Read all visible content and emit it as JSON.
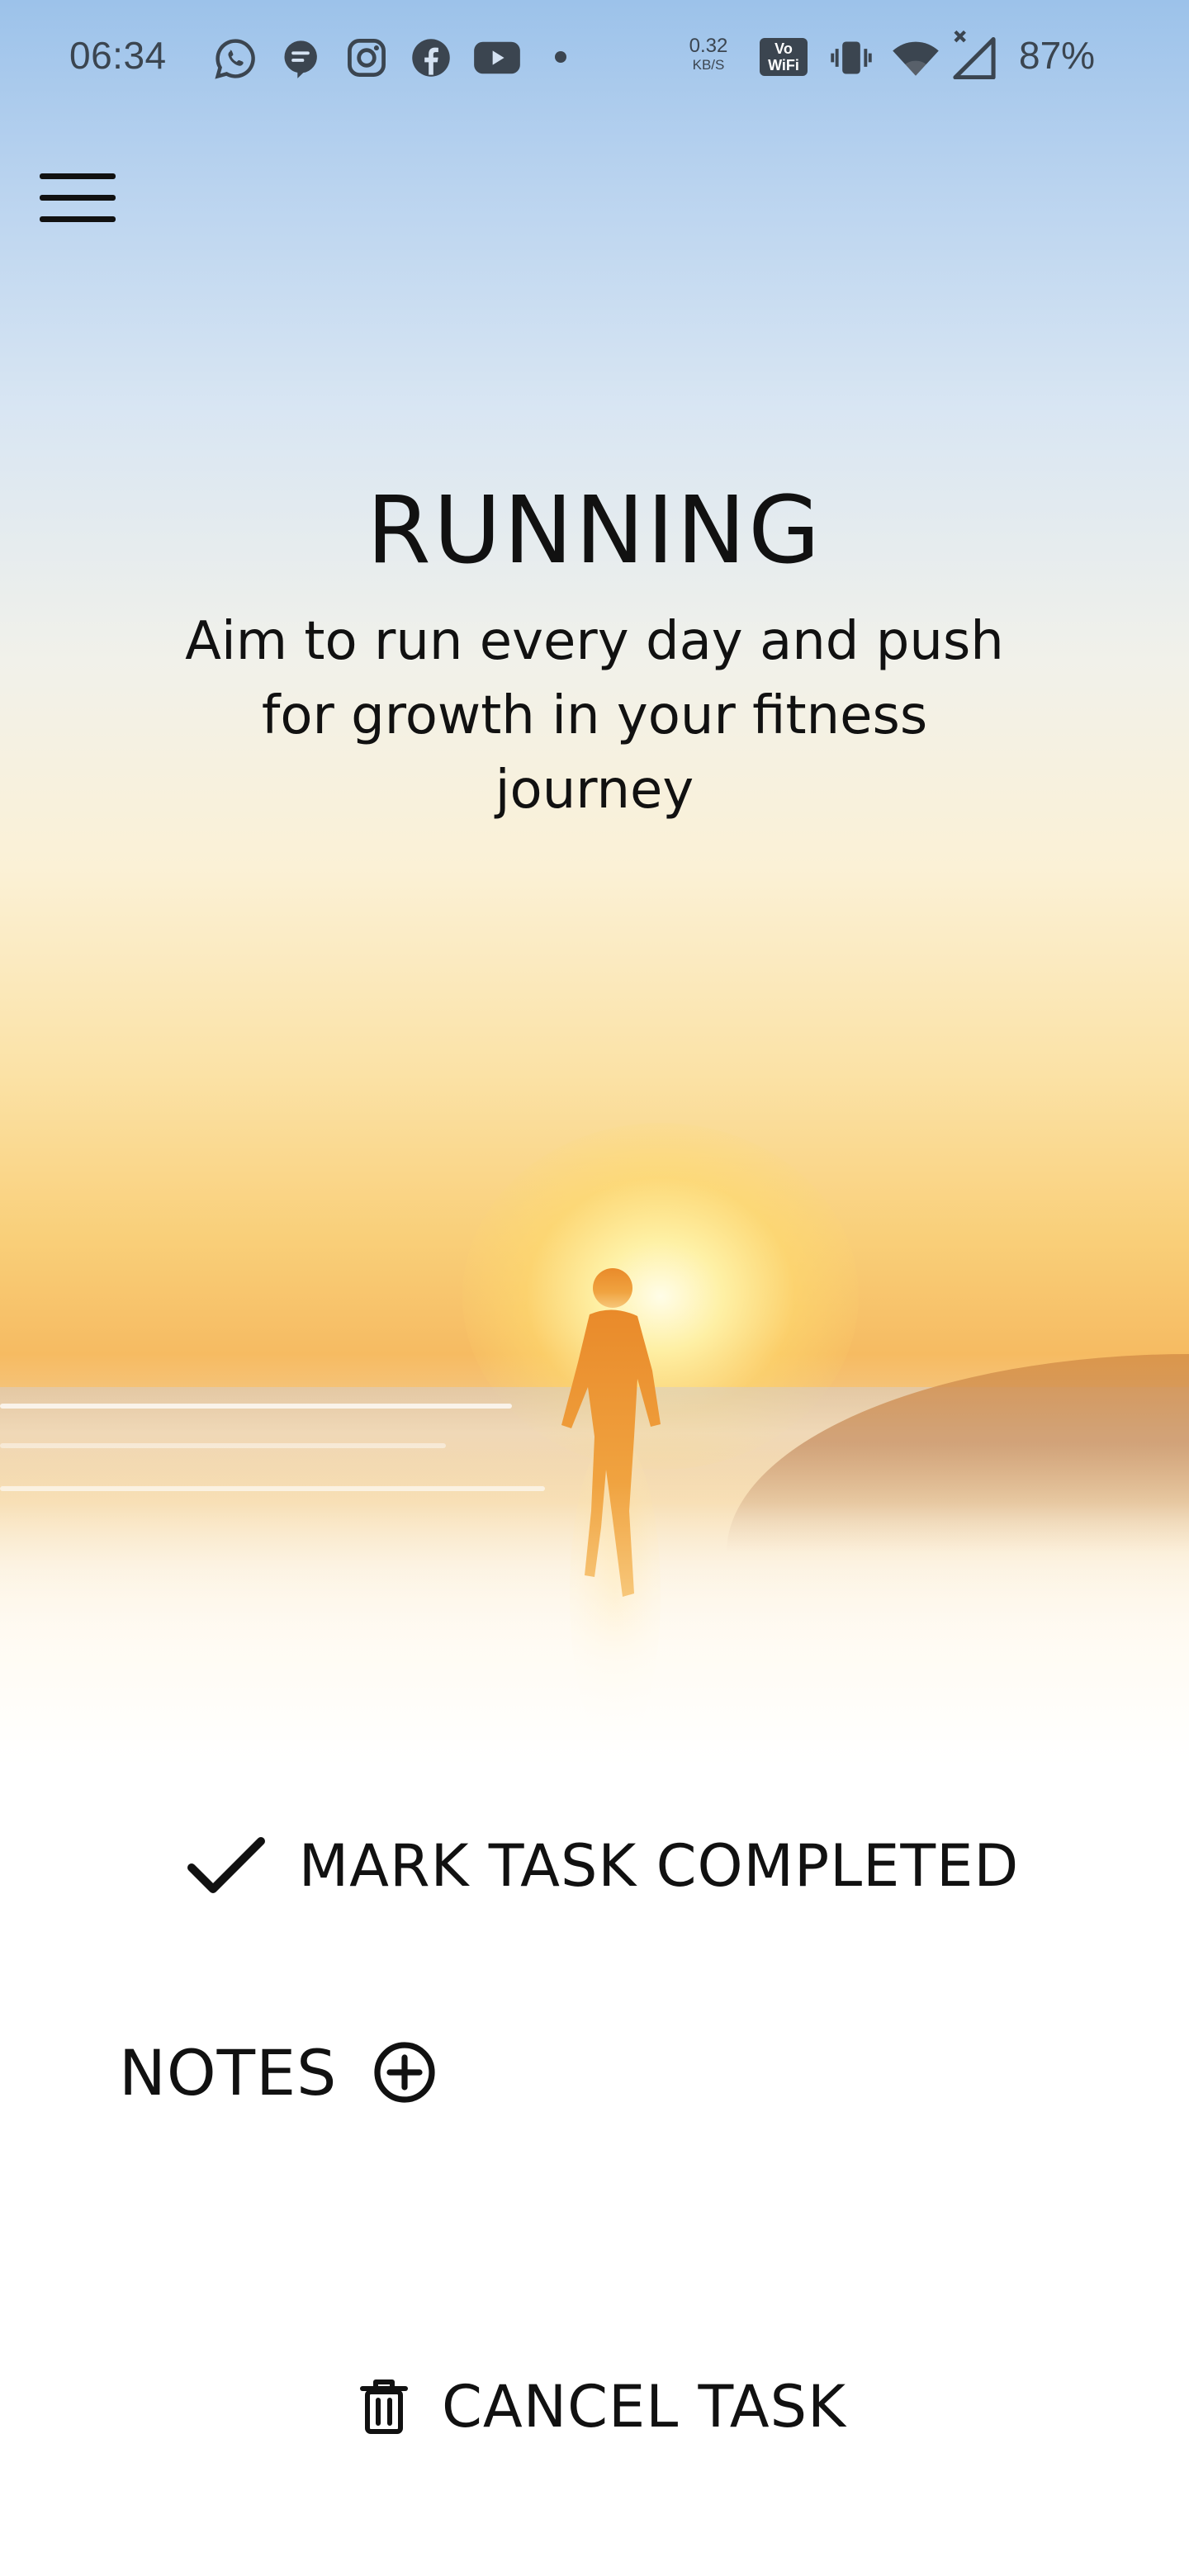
{
  "status_bar": {
    "time": "06:34",
    "net_speed_value": "0.32",
    "net_speed_unit": "KB/S",
    "vowifi_line1": "Vo",
    "vowifi_line2": "WiFi",
    "battery": "87%",
    "notification_icons": [
      "whatsapp-icon",
      "messages-icon",
      "instagram-icon",
      "facebook-icon",
      "youtube-icon",
      "more-dot-icon"
    ],
    "system_icons": [
      "vibrate-icon",
      "wifi-icon",
      "signal-icon"
    ]
  },
  "app_bar": {
    "menu_icon": "hamburger-menu-icon"
  },
  "task": {
    "title": "RUNNING",
    "subtitle": "Aim to run every day and push for growth in your fitness journey",
    "hero_image": "sunset-beach-runner"
  },
  "actions": {
    "mark_completed_label": "MARK TASK COMPLETED",
    "mark_completed_icon": "checkmark-icon",
    "notes_label": "NOTES",
    "add_note_icon": "add-circle-icon",
    "cancel_label": "CANCEL TASK",
    "cancel_icon": "trash-icon"
  }
}
